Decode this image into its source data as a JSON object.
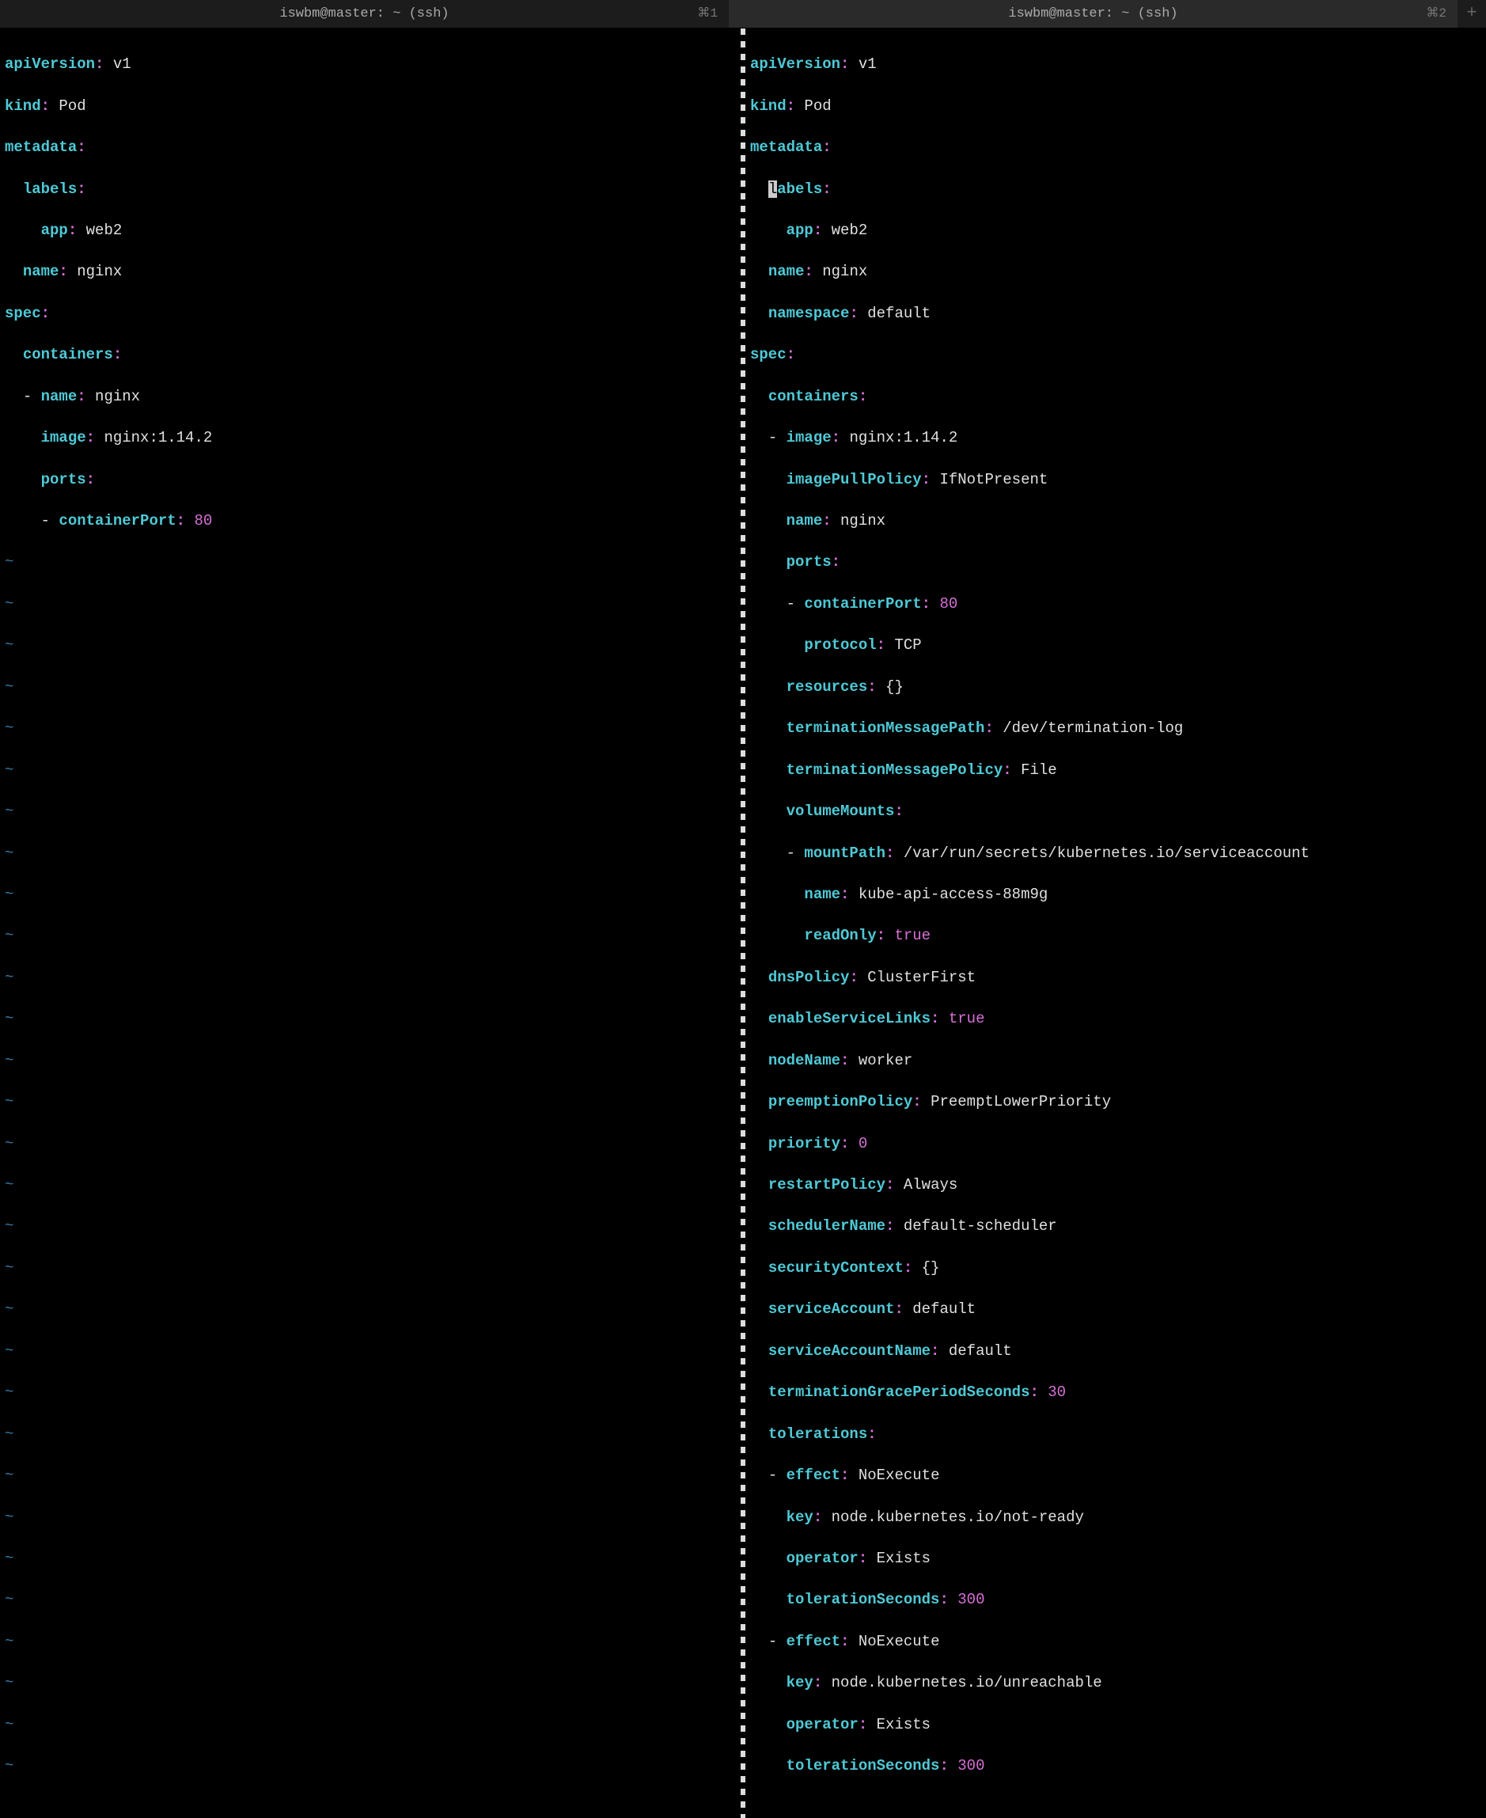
{
  "tabs": {
    "tab1": {
      "title": "iswbm@master: ~ (ssh)",
      "shortcut": "⌘1"
    },
    "tab2": {
      "title": "iswbm@master: ~ (ssh)",
      "shortcut": "⌘2"
    },
    "newTab": "+"
  },
  "left": {
    "l1k": "apiVersion",
    "l1v": "v1",
    "l2k": "kind",
    "l2v": "Pod",
    "l3k": "metadata",
    "l4k": "labels",
    "l5k": "app",
    "l5v": "web2",
    "l6k": "name",
    "l6v": "nginx",
    "l7k": "spec",
    "l8k": "containers",
    "l9k": "name",
    "l9v": "nginx",
    "l10k": "image",
    "l10v": "nginx:1.14.2",
    "l11k": "ports",
    "l12k": "containerPort",
    "l12v": "80",
    "tilde": "~"
  },
  "right": {
    "r1k": "apiVersion",
    "r1v": "v1",
    "r2k": "kind",
    "r2v": "Pod",
    "r3k": "metadata",
    "r4k": "abels",
    "r5k": "app",
    "r5v": "web2",
    "r6k": "name",
    "r6v": "nginx",
    "r7k": "namespace",
    "r7v": "default",
    "r8k": "spec",
    "r9k": "containers",
    "r10k": "image",
    "r10v": "nginx:1.14.2",
    "r11k": "imagePullPolicy",
    "r11v": "IfNotPresent",
    "r12k": "name",
    "r12v": "nginx",
    "r13k": "ports",
    "r14k": "containerPort",
    "r14v": "80",
    "r15k": "protocol",
    "r15v": "TCP",
    "r16k": "resources",
    "r16v": "{}",
    "r17k": "terminationMessagePath",
    "r17v": "/dev/termination-log",
    "r18k": "terminationMessagePolicy",
    "r18v": "File",
    "r19k": "volumeMounts",
    "r20k": "mountPath",
    "r20v": "/var/run/secrets/kubernetes.io/serviceaccount",
    "r21k": "name",
    "r21v": "kube-api-access-88m9g",
    "r22k": "readOnly",
    "r22v": "true",
    "r23k": "dnsPolicy",
    "r23v": "ClusterFirst",
    "r24k": "enableServiceLinks",
    "r24v": "true",
    "r25k": "nodeName",
    "r25v": "worker",
    "r26k": "preemptionPolicy",
    "r26v": "PreemptLowerPriority",
    "r27k": "priority",
    "r27v": "0",
    "r28k": "restartPolicy",
    "r28v": "Always",
    "r29k": "schedulerName",
    "r29v": "default-scheduler",
    "r30k": "securityContext",
    "r30v": "{}",
    "r31k": "serviceAccount",
    "r31v": "default",
    "r32k": "serviceAccountName",
    "r32v": "default",
    "r33k": "terminationGracePeriodSeconds",
    "r33v": "30",
    "r34k": "tolerations",
    "r35k": "effect",
    "r35v": "NoExecute",
    "r36k": "key",
    "r36v": "node.kubernetes.io/not-ready",
    "r37k": "operator",
    "r37v": "Exists",
    "r38k": "tolerationSeconds",
    "r38v": "300",
    "r39k": "effect",
    "r39v": "NoExecute",
    "r40k": "key",
    "r40v": "node.kubernetes.io/unreachable",
    "r41k": "operator",
    "r41v": "Exists",
    "r42k": "tolerationSeconds",
    "r42v": "300"
  }
}
